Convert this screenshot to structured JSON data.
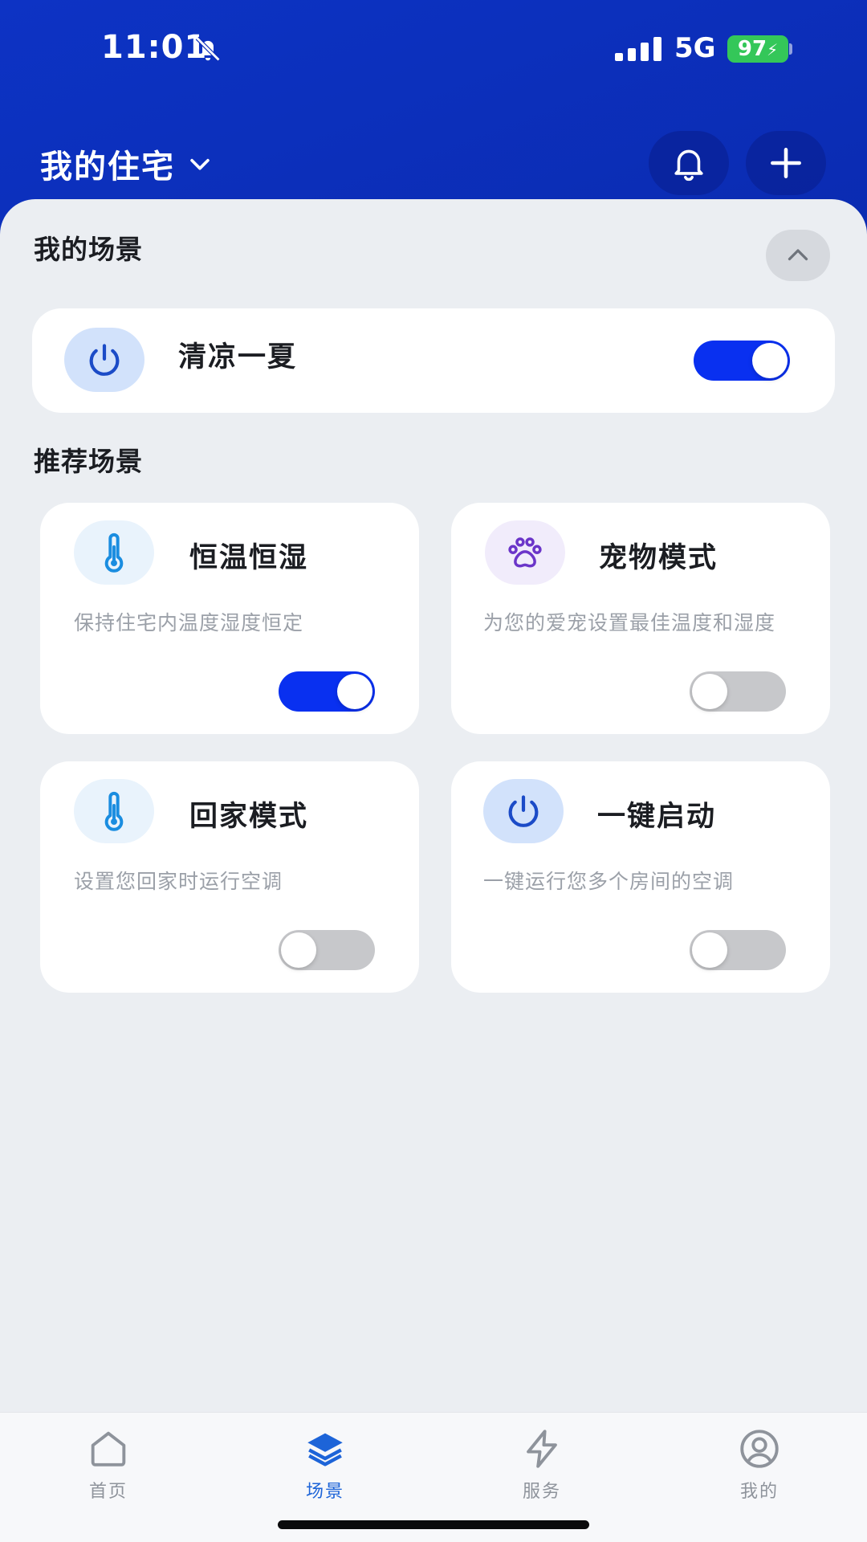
{
  "status_bar": {
    "time": "11:01",
    "network": "5G",
    "battery": "97"
  },
  "header": {
    "home_name": "我的住宅"
  },
  "my_scenes": {
    "title": "我的场景",
    "items": [
      {
        "name": "清凉一夏",
        "enabled": true
      }
    ]
  },
  "recommended": {
    "title": "推荐场景",
    "items": [
      {
        "name": "恒温恒湿",
        "desc": "保持住宅内温度湿度恒定",
        "icon": "thermometer-icon",
        "enabled": true
      },
      {
        "name": "宠物模式",
        "desc": "为您的爱宠设置最佳温度和湿度",
        "icon": "paw-icon",
        "enabled": false
      },
      {
        "name": "回家模式",
        "desc": "设置您回家时运行空调",
        "icon": "thermometer-icon",
        "enabled": false
      },
      {
        "name": "一键启动",
        "desc": "一键运行您多个房间的空调",
        "icon": "power-icon",
        "enabled": false
      }
    ]
  },
  "tab_bar": {
    "active": "场景",
    "tabs": [
      {
        "label": "首页",
        "icon": "home-icon"
      },
      {
        "label": "场景",
        "icon": "layers-icon"
      },
      {
        "label": "服务",
        "icon": "lightning-icon"
      },
      {
        "label": "我的",
        "icon": "profile-icon"
      }
    ]
  },
  "colors": {
    "accent": "#0930f0",
    "header": "#0b2cb8",
    "background": "#ebeef2"
  }
}
